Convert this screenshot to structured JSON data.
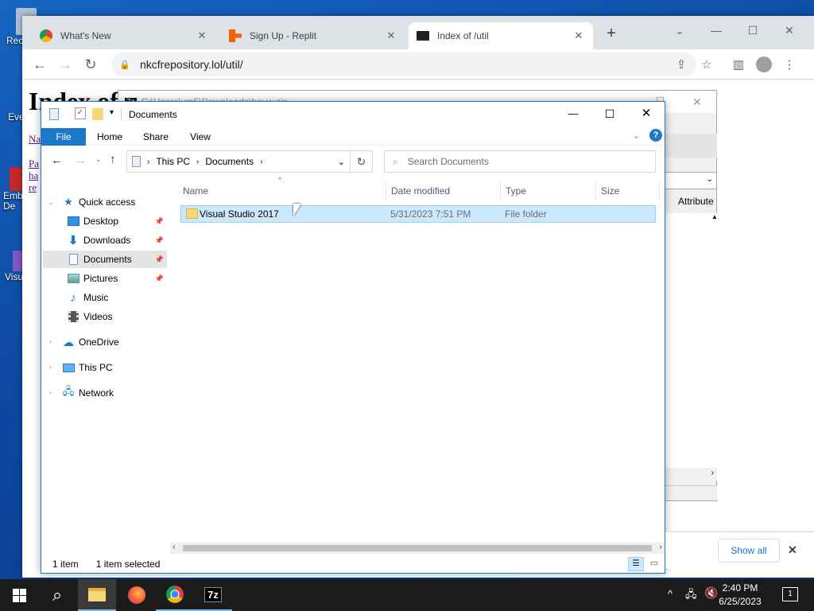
{
  "desktop": {
    "icons": [
      "Rec",
      "Eve",
      "Emb\nDe",
      "Visu"
    ]
  },
  "browser": {
    "tabs": [
      {
        "label": "What's New",
        "icon": "chrome-icon"
      },
      {
        "label": "Sign Up - Replit",
        "icon": "replit-icon"
      },
      {
        "label": "Index of /util",
        "icon": "folder-icon"
      }
    ],
    "url": "nkcfrepository.lol/util/",
    "page": {
      "title": "Index of",
      "links": [
        "Na",
        "Pa",
        "ha",
        "re"
      ]
    }
  },
  "zip_window": {
    "path": "C:\\Users\\vm5\\Downloads\\hayw.zip",
    "column": "Attribute"
  },
  "explorer": {
    "title": "Documents",
    "ribbon": [
      "File",
      "Home",
      "Share",
      "View"
    ],
    "breadcrumb": [
      "This PC",
      "Documents"
    ],
    "search_placeholder": "Search Documents",
    "tree": {
      "quick_access": "Quick access",
      "items": [
        "Desktop",
        "Downloads",
        "Documents",
        "Pictures",
        "Music",
        "Videos"
      ],
      "onedrive": "OneDrive",
      "this_pc": "This PC",
      "network": "Network"
    },
    "columns": [
      "Name",
      "Date modified",
      "Type",
      "Size"
    ],
    "files": [
      {
        "name": "Visual Studio 2017",
        "date": "5/31/2023 7:51 PM",
        "type": "File folder",
        "size": ""
      }
    ],
    "status": {
      "count": "1 item",
      "selected": "1 item selected"
    }
  },
  "downloads_bar": {
    "show_all": "Show all"
  },
  "taskbar": {
    "time": "2:40 PM",
    "date": "6/25/2023",
    "notifications": "1"
  },
  "colors": {
    "accent": "#1979ca",
    "selection": "#cce8ff",
    "taskbar": "#1b1b1b"
  }
}
